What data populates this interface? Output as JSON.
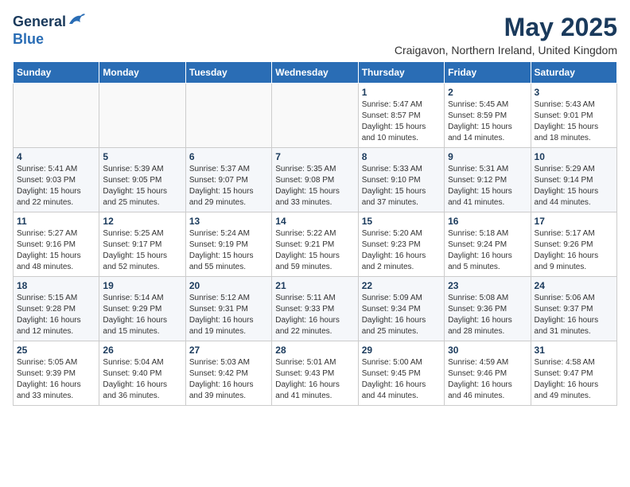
{
  "header": {
    "logo_general": "General",
    "logo_blue": "Blue",
    "month_title": "May 2025",
    "location": "Craigavon, Northern Ireland, United Kingdom"
  },
  "weekdays": [
    "Sunday",
    "Monday",
    "Tuesday",
    "Wednesday",
    "Thursday",
    "Friday",
    "Saturday"
  ],
  "weeks": [
    [
      {
        "day": "",
        "info": ""
      },
      {
        "day": "",
        "info": ""
      },
      {
        "day": "",
        "info": ""
      },
      {
        "day": "",
        "info": ""
      },
      {
        "day": "1",
        "info": "Sunrise: 5:47 AM\nSunset: 8:57 PM\nDaylight: 15 hours\nand 10 minutes."
      },
      {
        "day": "2",
        "info": "Sunrise: 5:45 AM\nSunset: 8:59 PM\nDaylight: 15 hours\nand 14 minutes."
      },
      {
        "day": "3",
        "info": "Sunrise: 5:43 AM\nSunset: 9:01 PM\nDaylight: 15 hours\nand 18 minutes."
      }
    ],
    [
      {
        "day": "4",
        "info": "Sunrise: 5:41 AM\nSunset: 9:03 PM\nDaylight: 15 hours\nand 22 minutes."
      },
      {
        "day": "5",
        "info": "Sunrise: 5:39 AM\nSunset: 9:05 PM\nDaylight: 15 hours\nand 25 minutes."
      },
      {
        "day": "6",
        "info": "Sunrise: 5:37 AM\nSunset: 9:07 PM\nDaylight: 15 hours\nand 29 minutes."
      },
      {
        "day": "7",
        "info": "Sunrise: 5:35 AM\nSunset: 9:08 PM\nDaylight: 15 hours\nand 33 minutes."
      },
      {
        "day": "8",
        "info": "Sunrise: 5:33 AM\nSunset: 9:10 PM\nDaylight: 15 hours\nand 37 minutes."
      },
      {
        "day": "9",
        "info": "Sunrise: 5:31 AM\nSunset: 9:12 PM\nDaylight: 15 hours\nand 41 minutes."
      },
      {
        "day": "10",
        "info": "Sunrise: 5:29 AM\nSunset: 9:14 PM\nDaylight: 15 hours\nand 44 minutes."
      }
    ],
    [
      {
        "day": "11",
        "info": "Sunrise: 5:27 AM\nSunset: 9:16 PM\nDaylight: 15 hours\nand 48 minutes."
      },
      {
        "day": "12",
        "info": "Sunrise: 5:25 AM\nSunset: 9:17 PM\nDaylight: 15 hours\nand 52 minutes."
      },
      {
        "day": "13",
        "info": "Sunrise: 5:24 AM\nSunset: 9:19 PM\nDaylight: 15 hours\nand 55 minutes."
      },
      {
        "day": "14",
        "info": "Sunrise: 5:22 AM\nSunset: 9:21 PM\nDaylight: 15 hours\nand 59 minutes."
      },
      {
        "day": "15",
        "info": "Sunrise: 5:20 AM\nSunset: 9:23 PM\nDaylight: 16 hours\nand 2 minutes."
      },
      {
        "day": "16",
        "info": "Sunrise: 5:18 AM\nSunset: 9:24 PM\nDaylight: 16 hours\nand 5 minutes."
      },
      {
        "day": "17",
        "info": "Sunrise: 5:17 AM\nSunset: 9:26 PM\nDaylight: 16 hours\nand 9 minutes."
      }
    ],
    [
      {
        "day": "18",
        "info": "Sunrise: 5:15 AM\nSunset: 9:28 PM\nDaylight: 16 hours\nand 12 minutes."
      },
      {
        "day": "19",
        "info": "Sunrise: 5:14 AM\nSunset: 9:29 PM\nDaylight: 16 hours\nand 15 minutes."
      },
      {
        "day": "20",
        "info": "Sunrise: 5:12 AM\nSunset: 9:31 PM\nDaylight: 16 hours\nand 19 minutes."
      },
      {
        "day": "21",
        "info": "Sunrise: 5:11 AM\nSunset: 9:33 PM\nDaylight: 16 hours\nand 22 minutes."
      },
      {
        "day": "22",
        "info": "Sunrise: 5:09 AM\nSunset: 9:34 PM\nDaylight: 16 hours\nand 25 minutes."
      },
      {
        "day": "23",
        "info": "Sunrise: 5:08 AM\nSunset: 9:36 PM\nDaylight: 16 hours\nand 28 minutes."
      },
      {
        "day": "24",
        "info": "Sunrise: 5:06 AM\nSunset: 9:37 PM\nDaylight: 16 hours\nand 31 minutes."
      }
    ],
    [
      {
        "day": "25",
        "info": "Sunrise: 5:05 AM\nSunset: 9:39 PM\nDaylight: 16 hours\nand 33 minutes."
      },
      {
        "day": "26",
        "info": "Sunrise: 5:04 AM\nSunset: 9:40 PM\nDaylight: 16 hours\nand 36 minutes."
      },
      {
        "day": "27",
        "info": "Sunrise: 5:03 AM\nSunset: 9:42 PM\nDaylight: 16 hours\nand 39 minutes."
      },
      {
        "day": "28",
        "info": "Sunrise: 5:01 AM\nSunset: 9:43 PM\nDaylight: 16 hours\nand 41 minutes."
      },
      {
        "day": "29",
        "info": "Sunrise: 5:00 AM\nSunset: 9:45 PM\nDaylight: 16 hours\nand 44 minutes."
      },
      {
        "day": "30",
        "info": "Sunrise: 4:59 AM\nSunset: 9:46 PM\nDaylight: 16 hours\nand 46 minutes."
      },
      {
        "day": "31",
        "info": "Sunrise: 4:58 AM\nSunset: 9:47 PM\nDaylight: 16 hours\nand 49 minutes."
      }
    ]
  ]
}
